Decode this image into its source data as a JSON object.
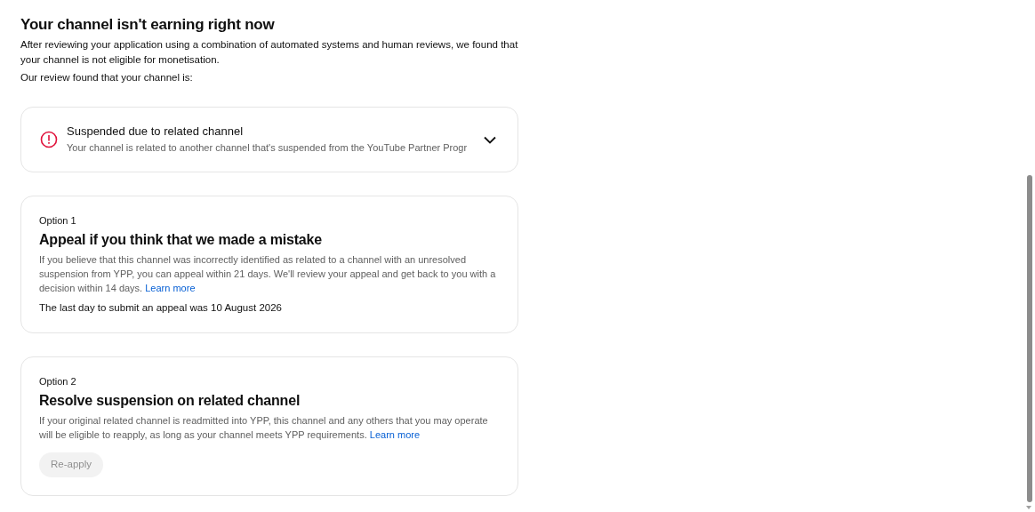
{
  "heading": "Your channel isn't earning right now",
  "intro": [
    "After reviewing your application using a combination of automated systems and human reviews, we found that your channel is not eligible for monetisation.",
    "Our review found that your channel is:"
  ],
  "reason": {
    "title": "Suspended due to related channel",
    "description": "Your channel is related to another channel that's suspended from the YouTube Partner Progr",
    "expanded": false
  },
  "options": [
    {
      "label": "Option 1",
      "title": "Appeal if you think that we made a mistake",
      "body": "If you believe that this channel was incorrectly identified as related to a channel with an unresolved suspension from YPP, you can appeal within 21 days. We'll review your appeal and get back to you with a decision within 14 days.",
      "link": "Learn more",
      "note": "The last day to submit an appeal was 10 August 2026"
    },
    {
      "label": "Option 2",
      "title": "Resolve suspension on related channel",
      "body": "If your original related channel is readmitted into YPP, this channel and any others that you may operate will be eligible to reapply, as long as your channel meets YPP requirements.",
      "link": "Learn more",
      "button": {
        "label": "Re-apply",
        "disabled": true
      }
    }
  ]
}
